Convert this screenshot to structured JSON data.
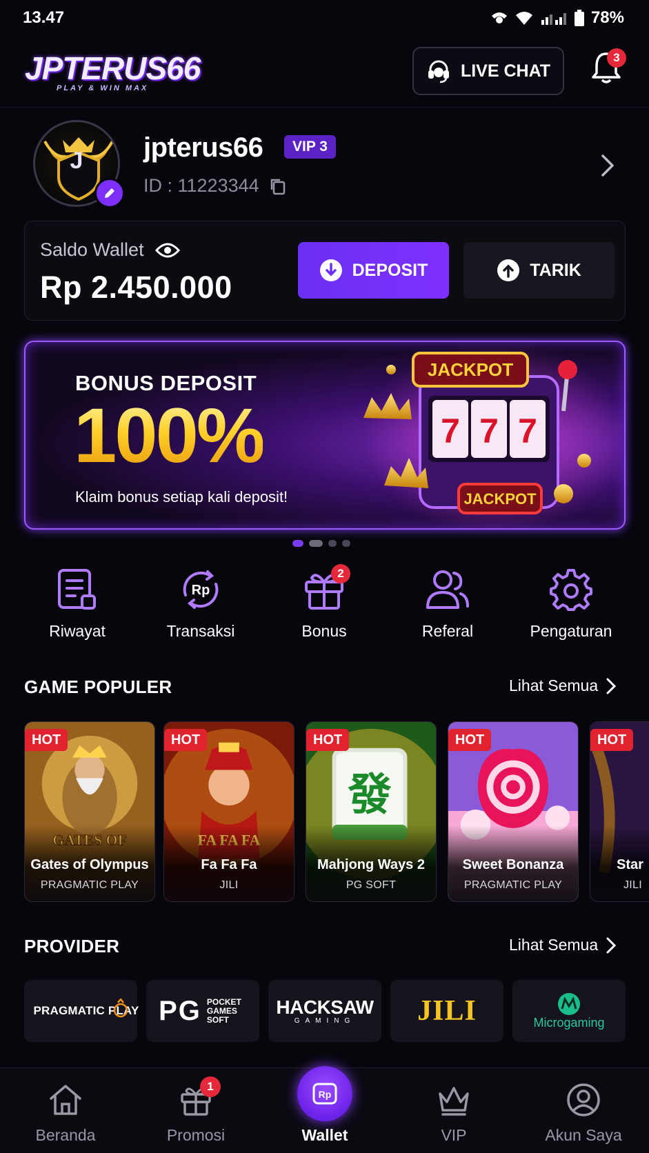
{
  "status_bar": {
    "time": "13.47",
    "battery": "78%"
  },
  "header": {
    "logo_text": "JPTERUS66",
    "logo_tagline": "PLAY & WIN MAX",
    "live_chat_label": "LIVE CHAT",
    "notification_count": "3"
  },
  "profile": {
    "avatar_letter": "J",
    "username": "jpterus66",
    "vip_level": "VIP 3",
    "user_id": "ID : 11223344"
  },
  "wallet": {
    "label": "Saldo Wallet",
    "amount": "Rp 2.450.000",
    "deposit_label": "DEPOSIT",
    "withdraw_label": "TARIK"
  },
  "banner": {
    "title": "BONUS DEPOSIT",
    "highlight": "100%",
    "subtitle": "Klaim bonus setiap kali deposit!",
    "jackpot_top": "JACKPOT",
    "jackpot_bottom": "JACKPOT",
    "slot_reels": [
      "7",
      "7",
      "7"
    ],
    "active_slide": 1,
    "slide_count": 4
  },
  "quick_menu": [
    {
      "label": "Riwayat",
      "icon": "history-list-icon"
    },
    {
      "label": "Transaksi",
      "icon": "transaction-rp-icon"
    },
    {
      "label": "Bonus",
      "icon": "gift-icon",
      "badge": "2"
    },
    {
      "label": "Referal",
      "icon": "users-icon"
    },
    {
      "label": "Pengaturan",
      "icon": "settings-gear-icon"
    }
  ],
  "popular_games": {
    "title": "GAME POPULER",
    "see_all": "Lihat Semua",
    "items": [
      {
        "name": "Gates of Olympus",
        "provider": "PRAGMATIC PLAY",
        "tag": "HOT",
        "art_text": "GATES OF OLYMPUS"
      },
      {
        "name": "Fa Fa Fa",
        "provider": "JILI",
        "tag": "HOT",
        "art_text": "FA FA FA"
      },
      {
        "name": "Mahjong Ways 2",
        "provider": "PG SOFT",
        "tag": "HOT"
      },
      {
        "name": "Sweet Bonanza",
        "provider": "PRAGMATIC PLAY",
        "tag": "HOT"
      },
      {
        "name": "Star",
        "provider": "JILI",
        "tag": "HOT"
      }
    ]
  },
  "providers": {
    "title": "PROVIDER",
    "see_all": "Lihat Semua",
    "items": [
      {
        "name": "PRAGMATIC PLAY"
      },
      {
        "name": "PG",
        "sub": "POCKET GAMES SOFT"
      },
      {
        "name": "HACKSAW",
        "sub": "GAMING"
      },
      {
        "name": "JILI"
      },
      {
        "name": "Microgaming"
      }
    ]
  },
  "bottom_nav": {
    "items": [
      {
        "label": "Beranda",
        "icon": "home-icon"
      },
      {
        "label": "Promosi",
        "icon": "gift-icon",
        "badge": "1"
      },
      {
        "label": "Wallet",
        "icon": "wallet-rp-icon",
        "active": true
      },
      {
        "label": "VIP",
        "icon": "crown-icon"
      },
      {
        "label": "Akun Saya",
        "icon": "user-circle-icon"
      }
    ]
  },
  "colors": {
    "background": "#07060c",
    "accent_purple": "#7c3aed",
    "hot_red": "#e1232f",
    "gold": "#ffd43b"
  }
}
